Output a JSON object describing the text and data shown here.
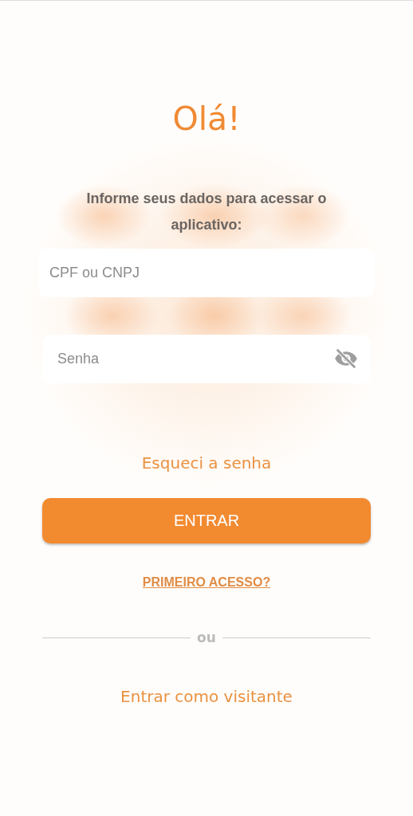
{
  "greeting": "Olá!",
  "instructions": "Informe seus dados para acessar o aplicativo:",
  "fields": [
    {
      "kind": "text",
      "placeholder": "CPF ou CNPJ"
    },
    {
      "kind": "password",
      "placeholder": "Senha",
      "password_hidden": true
    }
  ],
  "forgot_link": "Esqueci a senha",
  "login_button": "ENTRAR",
  "first_access_link": "PRIMEIRO ACESSO?",
  "divider_text": "ou",
  "guest_link": "Entrar como visitante"
}
